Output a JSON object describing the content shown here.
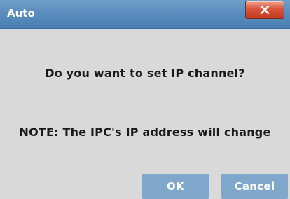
{
  "window": {
    "title": "Auto",
    "close_icon": "close-icon"
  },
  "dialog": {
    "question": "Do you want to set IP channel?",
    "note": "NOTE: The IPC's IP address will change"
  },
  "buttons": {
    "ok_label": "OK",
    "cancel_label": "Cancel"
  },
  "colors": {
    "titlebar": "#5a8dbe",
    "close_button": "#d9533a",
    "button": "#7fa7cc",
    "background": "#d9d9d9"
  }
}
